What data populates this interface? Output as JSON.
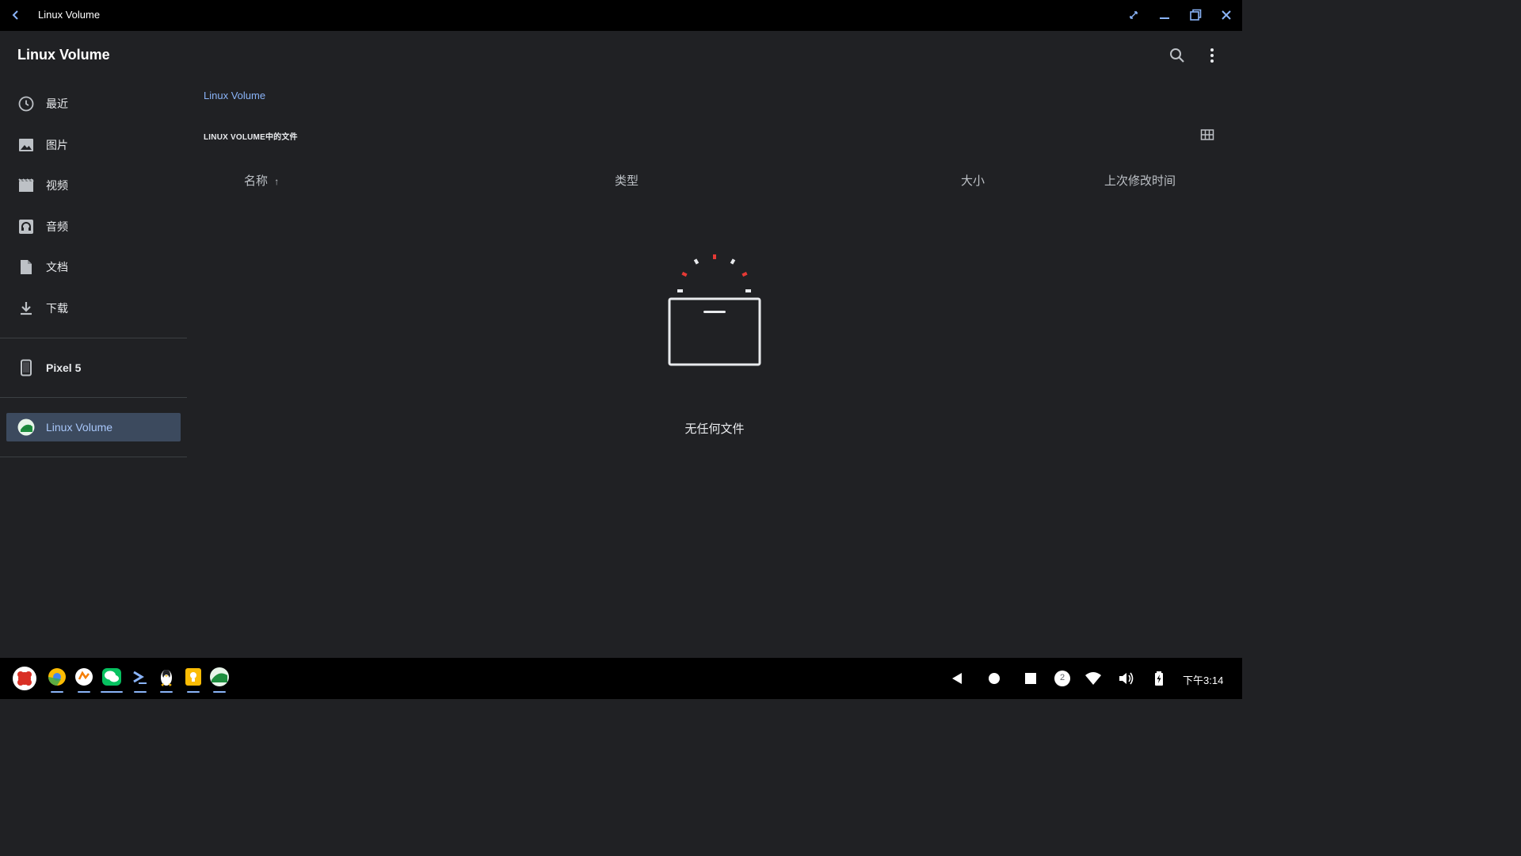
{
  "window": {
    "title": "Linux Volume"
  },
  "app": {
    "title": "Linux Volume"
  },
  "sidebar": {
    "items": [
      {
        "label": "最近",
        "icon": "clock-icon"
      },
      {
        "label": "图片",
        "icon": "image-icon"
      },
      {
        "label": "视频",
        "icon": "video-icon"
      },
      {
        "label": "音频",
        "icon": "headphones-icon"
      },
      {
        "label": "文档",
        "icon": "document-icon"
      },
      {
        "label": "下载",
        "icon": "download-icon"
      }
    ],
    "devices": [
      {
        "label": "Pixel 5",
        "icon": "phone-icon"
      }
    ],
    "volumes": [
      {
        "label": "Linux Volume",
        "icon": "linux-volume-icon",
        "active": true
      }
    ]
  },
  "main": {
    "breadcrumb": "Linux Volume",
    "section_title": "LINUX VOLUME中的文件",
    "columns": {
      "name": "名称",
      "type": "类型",
      "size": "大小",
      "modified": "上次修改时间"
    },
    "sort_indicator": "↑",
    "empty_message": "无任何文件"
  },
  "shelf": {
    "apps": [
      "launcher-icon",
      "chrome-canary-icon",
      "app-orange-icon",
      "wechat-icon",
      "terminal-icon",
      "linux-penguin-icon",
      "keep-icon",
      "files-icon"
    ],
    "notification_count": "2",
    "clock": "下午3:14"
  },
  "colors": {
    "background": "#202124",
    "accent": "#8ab4f8",
    "active_bg": "#3c4a5e",
    "titlebar": "#000000"
  }
}
